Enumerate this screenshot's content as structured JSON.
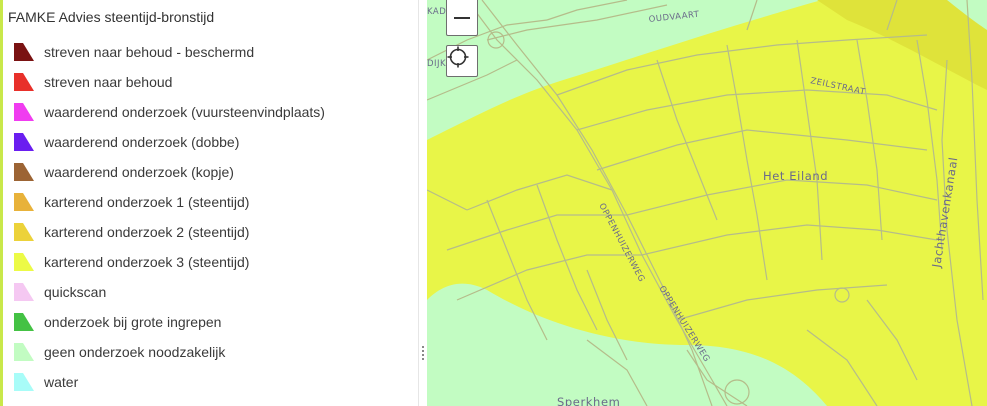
{
  "legend": {
    "title": "FAMKE Advies steentijd-bronstijd",
    "items": [
      {
        "label": "streven naar behoud - beschermd",
        "color": "#7a1212",
        "icon": "polygon-swatch"
      },
      {
        "label": "streven naar behoud",
        "color": "#e8302a",
        "icon": "polygon-swatch"
      },
      {
        "label": "waarderend onderzoek (vuursteenvindplaats)",
        "color": "#f03cf0",
        "icon": "polygon-swatch"
      },
      {
        "label": "waarderend onderzoek (dobbe)",
        "color": "#6a1ef0",
        "icon": "polygon-swatch"
      },
      {
        "label": "waarderend onderzoek (kopje)",
        "color": "#9c6434",
        "icon": "polygon-swatch"
      },
      {
        "label": "karterend onderzoek 1 (steentijd)",
        "color": "#e8b23a",
        "icon": "polygon-swatch"
      },
      {
        "label": "karterend onderzoek 2 (steentijd)",
        "color": "#ecd23a",
        "icon": "polygon-swatch"
      },
      {
        "label": "karterend onderzoek 3 (steentijd)",
        "color": "#ecfa46",
        "icon": "polygon-swatch"
      },
      {
        "label": "quickscan",
        "color": "#f5c8f2",
        "icon": "polygon-swatch"
      },
      {
        "label": "onderzoek bij grote ingrepen",
        "color": "#44c244",
        "icon": "polygon-swatch"
      },
      {
        "label": "geen onderzoek noodzakelijk",
        "color": "#c2fcc2",
        "icon": "polygon-swatch"
      },
      {
        "label": "water",
        "color": "#a8fcf8",
        "icon": "polygon-swatch"
      }
    ]
  },
  "map": {
    "labels": {
      "kade": "KAD",
      "oudvaart": "OUDVAART",
      "dijk": "DIJK",
      "zeilstraat": "ZEILSTRAAT",
      "het_eiland": "Het Eiland",
      "jachthavenkanaal": "Jachthavenkanaal",
      "oppenhuizerweg_1": "OPPENHUIZERWEG",
      "oppenhuizerweg_2": "OPPENHUIZERWEG",
      "oppenhuizerweg_3": "OPPENHUIZERWEG",
      "sperkhem": "Sperkhem"
    },
    "colors": {
      "yellow_zone": "#e8f548",
      "green_zone": "#c2fcc2",
      "road": "#b5bc8a"
    }
  },
  "controls": {
    "zoom_out": "zoom-out",
    "locate": "locate"
  }
}
